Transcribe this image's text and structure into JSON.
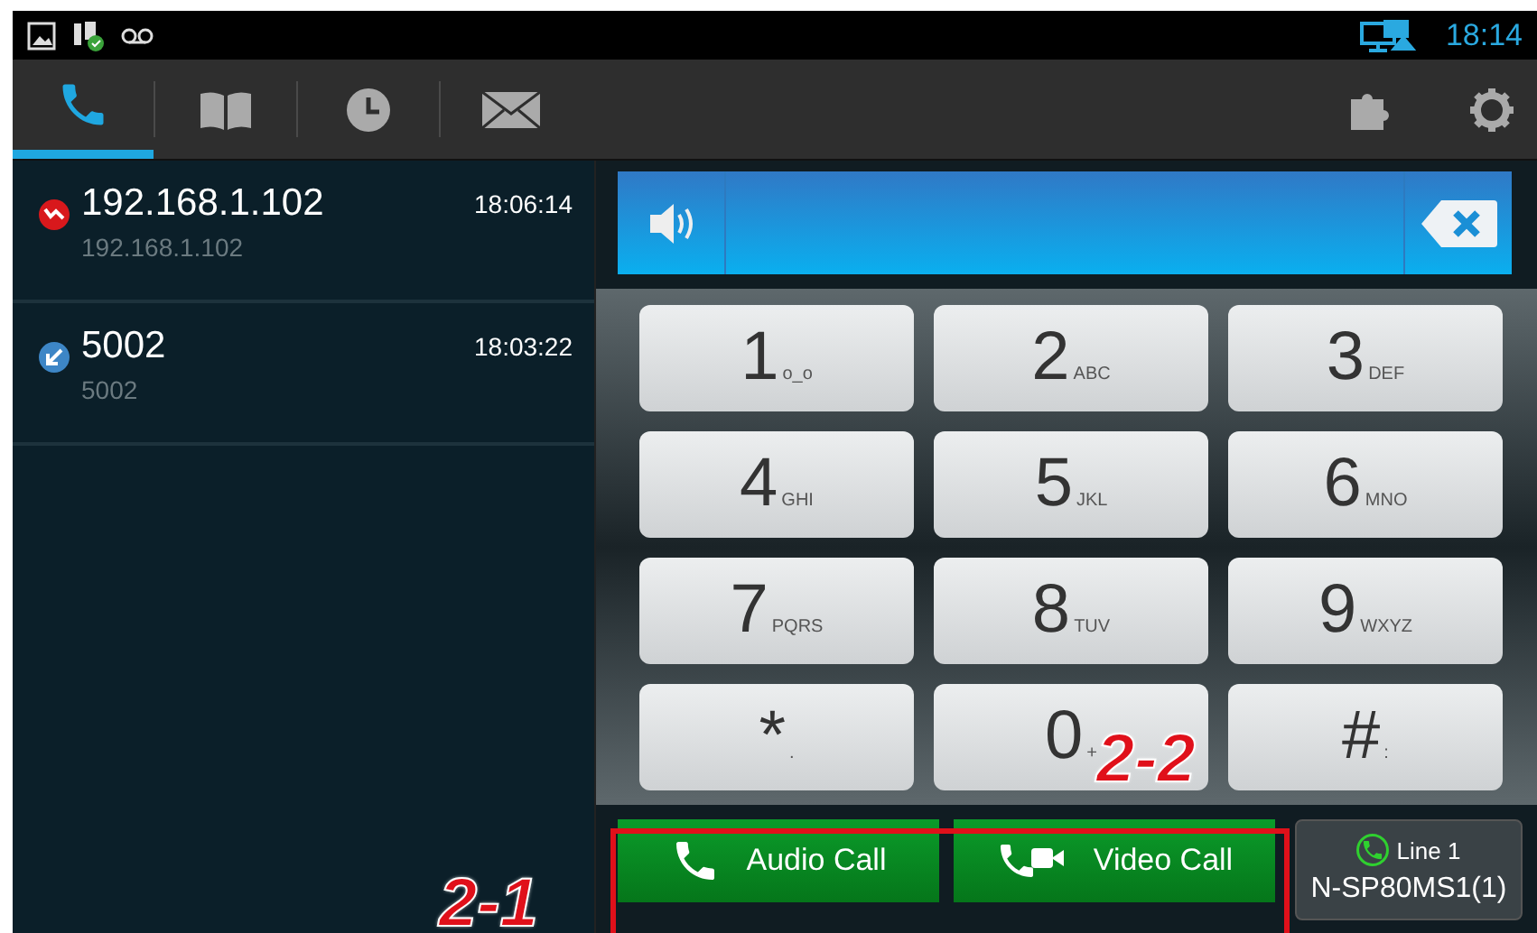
{
  "status_bar": {
    "time": "18:14"
  },
  "tabs": [
    {
      "kind": "phone",
      "selected": true
    },
    {
      "kind": "book",
      "selected": false
    },
    {
      "kind": "clock",
      "selected": false
    },
    {
      "kind": "mail",
      "selected": false
    }
  ],
  "call_log": [
    {
      "kind": "missed",
      "name": "192.168.1.102",
      "number": "192.168.1.102",
      "time": "18:06:14"
    },
    {
      "kind": "incoming",
      "name": "5002",
      "number": "5002",
      "time": "18:03:22"
    }
  ],
  "keypad": [
    {
      "digit": "1",
      "letters": "o_o"
    },
    {
      "digit": "2",
      "letters": "ABC"
    },
    {
      "digit": "3",
      "letters": "DEF"
    },
    {
      "digit": "4",
      "letters": "GHI"
    },
    {
      "digit": "5",
      "letters": "JKL"
    },
    {
      "digit": "6",
      "letters": "MNO"
    },
    {
      "digit": "7",
      "letters": "PQRS"
    },
    {
      "digit": "8",
      "letters": "TUV"
    },
    {
      "digit": "9",
      "letters": "WXYZ"
    },
    {
      "digit": "*",
      "letters": "."
    },
    {
      "digit": "0",
      "letters": "+"
    },
    {
      "digit": "#",
      "letters": ":"
    }
  ],
  "buttons": [
    {
      "kind": "audio",
      "label": "Audio Call"
    },
    {
      "kind": "video",
      "label": "Video Call"
    }
  ],
  "line": {
    "label": "Line 1",
    "account": "N-SP80MS1(1)"
  },
  "annotations": [
    {
      "label": "2-1"
    },
    {
      "label": "2-2"
    }
  ]
}
